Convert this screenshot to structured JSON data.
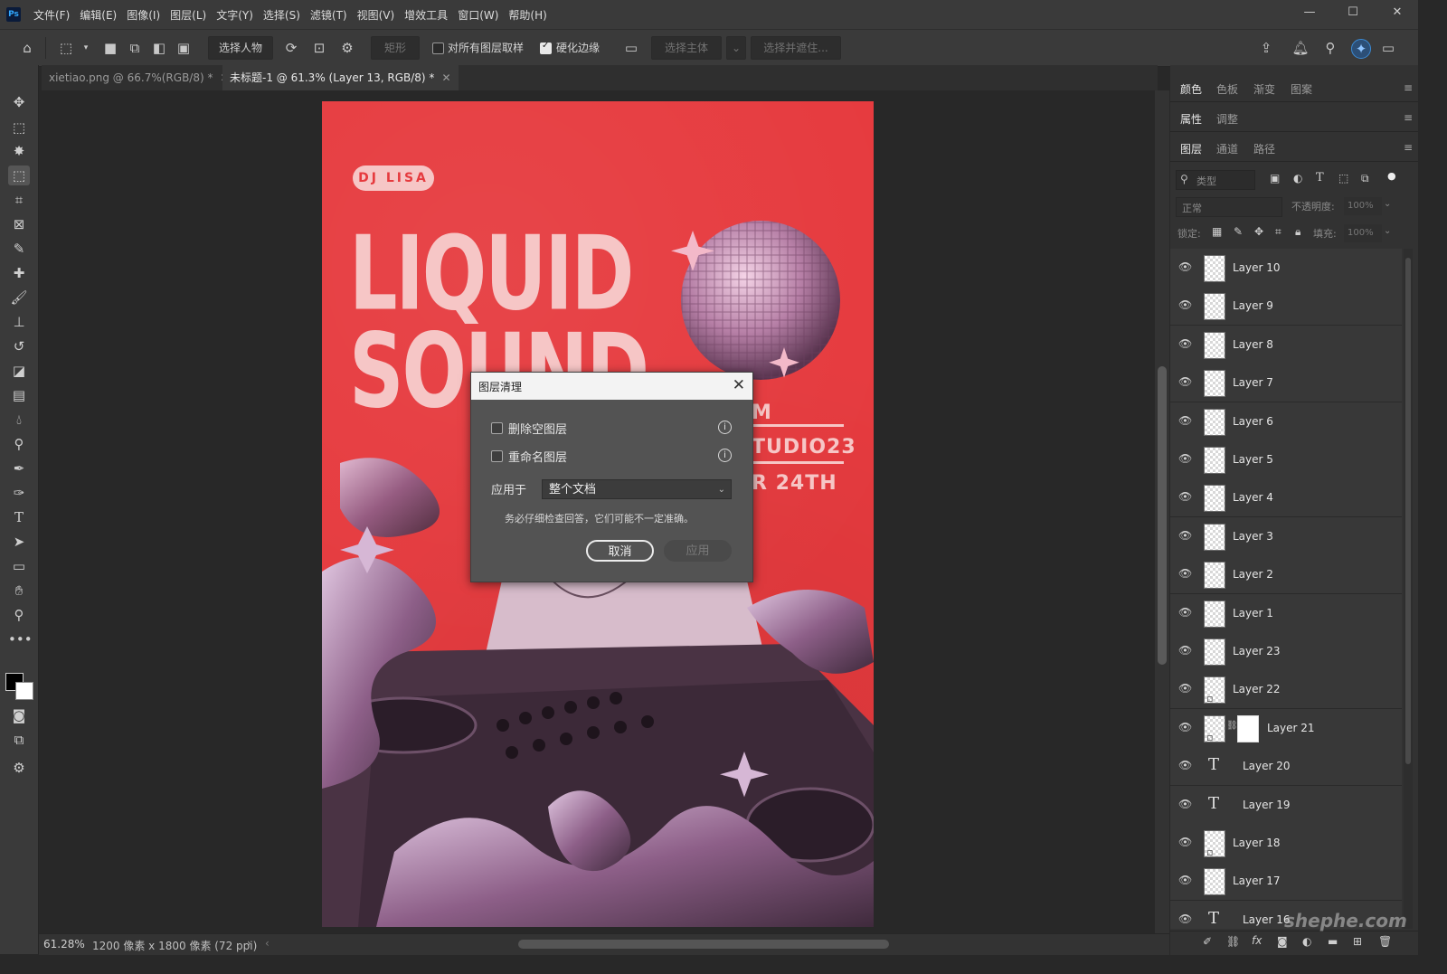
{
  "menubar": {
    "app_icon": "Ps",
    "items": [
      "文件(F)",
      "编辑(E)",
      "图像(I)",
      "图层(L)",
      "文字(Y)",
      "选择(S)",
      "滤镜(T)",
      "视图(V)",
      "增效工具",
      "窗口(W)",
      "帮助(H)"
    ],
    "window_controls": {
      "minimize": "—",
      "maximize": "☐",
      "close": "✕"
    }
  },
  "options_bar": {
    "select_subject_btn": "选择人物",
    "shape_select": "矩形",
    "sample_all_label": "对所有图层取样",
    "sample_all_checked": false,
    "harden_edge_label": "硬化边缘",
    "harden_edge_checked": true,
    "select_subject_main": "选择主体",
    "select_and_mask": "选择并遮住..."
  },
  "tabs": [
    {
      "label": "xietiao.png @ 66.7%(RGB/8) *",
      "active": false
    },
    {
      "label": "未标题-1 @ 61.3% (Layer 13, RGB/8) *",
      "active": true
    }
  ],
  "artwork": {
    "pill": "DJ LISA",
    "title_line1": "LIQUID",
    "title_line2": "SOUND",
    "right_line1": "M",
    "right_line2": "TUDIO23",
    "right_line3": "R 24TH",
    "colors": {
      "background": "#e63a3e",
      "pink": "#f6c6c6",
      "chrome": "#b28ab0"
    }
  },
  "dialog": {
    "title": "图层清理",
    "option1": "删除空图层",
    "option1_checked": false,
    "option2": "重命名图层",
    "option2_checked": false,
    "apply_to_label": "应用于",
    "apply_to_value": "整个文档",
    "warning": "务必仔细检查回答，它们可能不一定准确。",
    "cancel": "取消",
    "apply": "应用"
  },
  "right_panel": {
    "group1_tabs": [
      "颜色",
      "色板",
      "渐变",
      "图案"
    ],
    "group2_tabs": [
      "属性",
      "调整"
    ],
    "group3_tabs": [
      "图层",
      "通道",
      "路径"
    ],
    "filter_placeholder": "类型",
    "blend_mode": "正常",
    "opacity_label": "不透明度:",
    "opacity_value": "100%",
    "lock_label": "锁定:",
    "fill_label": "填充:",
    "fill_value": "100%",
    "layers": [
      {
        "name": "Layer 10",
        "kind": "pixel"
      },
      {
        "name": "Layer 9",
        "kind": "pixel"
      },
      {
        "name": "Layer 8",
        "kind": "pixel"
      },
      {
        "name": "Layer 7",
        "kind": "pixel"
      },
      {
        "name": "Layer 6",
        "kind": "pixel"
      },
      {
        "name": "Layer 5",
        "kind": "pixel"
      },
      {
        "name": "Layer 4",
        "kind": "pixel"
      },
      {
        "name": "Layer 3",
        "kind": "pixel"
      },
      {
        "name": "Layer 2",
        "kind": "pixel"
      },
      {
        "name": "Layer 1",
        "kind": "pixel"
      },
      {
        "name": "Layer 23",
        "kind": "pixel"
      },
      {
        "name": "Layer 22",
        "kind": "smart"
      },
      {
        "name": "Layer 21",
        "kind": "masked"
      },
      {
        "name": "Layer 20",
        "kind": "text"
      },
      {
        "name": "Layer 19",
        "kind": "text"
      },
      {
        "name": "Layer 18",
        "kind": "smart"
      },
      {
        "name": "Layer 17",
        "kind": "pixel"
      },
      {
        "name": "Layer 16",
        "kind": "text"
      }
    ]
  },
  "status": {
    "zoom": "61.28%",
    "doc_info": "1200 像素 x 1800 像素 (72 ppi)",
    "watermark": "shephe.com"
  }
}
